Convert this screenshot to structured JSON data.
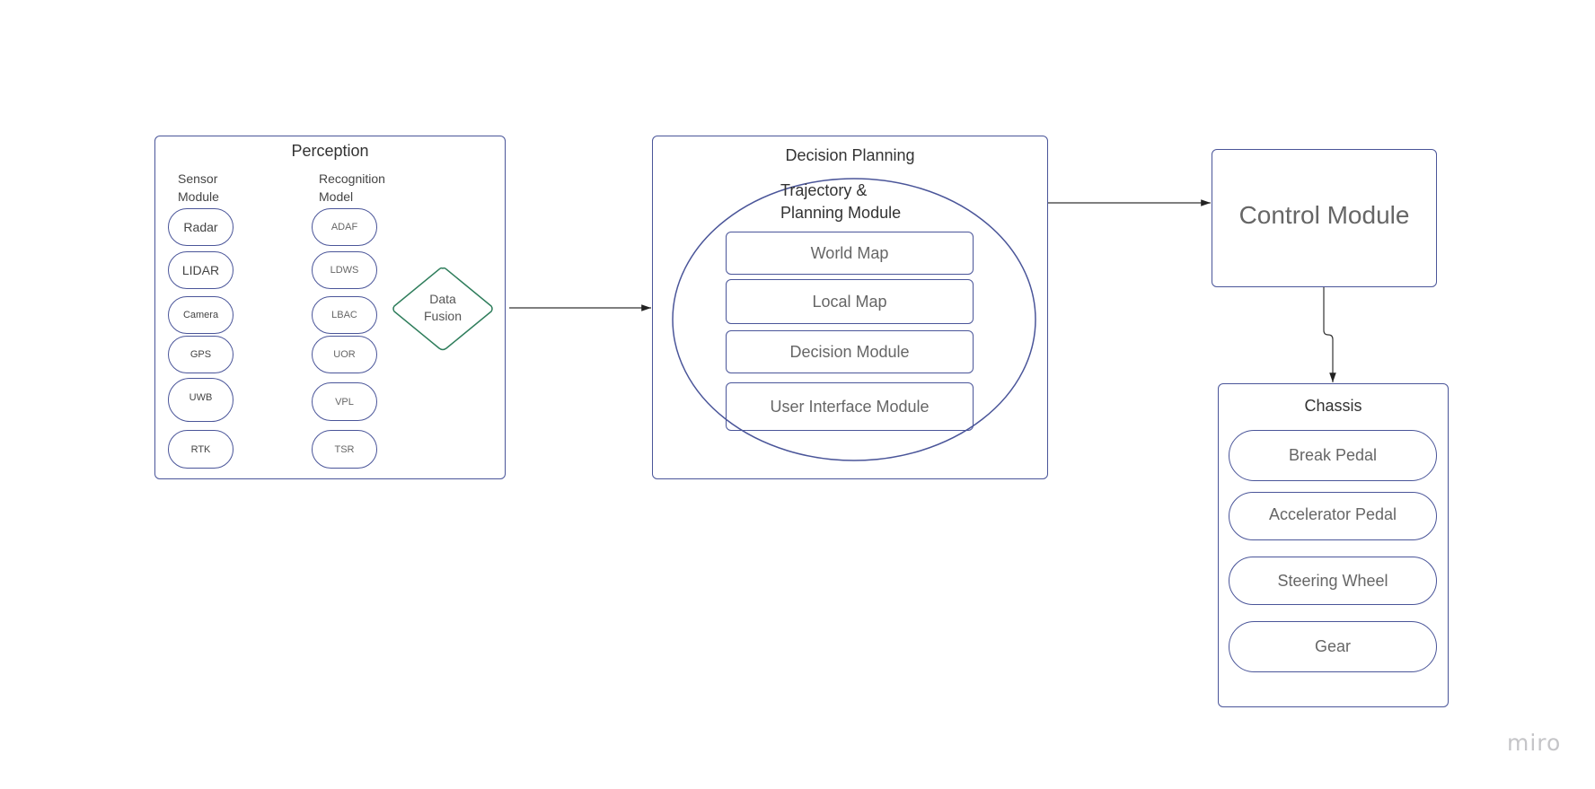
{
  "watermark": "miro",
  "colors": {
    "stroke": "#4a5599",
    "fusion_stroke": "#2e7d5b",
    "connector": "#333333",
    "text_dark": "#333333",
    "text_grey": "#666666"
  },
  "perception": {
    "title": "Perception",
    "sensor_heading": [
      "Sensor",
      "Module"
    ],
    "recognition_heading": [
      "Recognition",
      "Model"
    ],
    "sensors": [
      "Radar",
      "LIDAR",
      "Camera",
      "GPS",
      "UWB",
      "RTK"
    ],
    "recognition": [
      "ADAF",
      "LDWS",
      "LBAC",
      "UOR",
      "VPL",
      "TSR"
    ],
    "fusion": [
      "Data",
      "Fusion"
    ]
  },
  "decision_planning": {
    "title": "Decision Planning",
    "module_title": [
      "Trajectory &",
      "Planning Module"
    ],
    "items": [
      "World Map",
      "Local Map",
      "Decision Module",
      "User Interface Module"
    ]
  },
  "control": {
    "title": "Control Module"
  },
  "chassis": {
    "title": "Chassis",
    "items": [
      "Break Pedal",
      "Accelerator Pedal",
      "Steering Wheel",
      "Gear"
    ]
  },
  "connectors": [
    {
      "from": "perception",
      "to": "decision_planning"
    },
    {
      "from": "decision_planning",
      "to": "control"
    },
    {
      "from": "control",
      "to": "chassis"
    }
  ]
}
